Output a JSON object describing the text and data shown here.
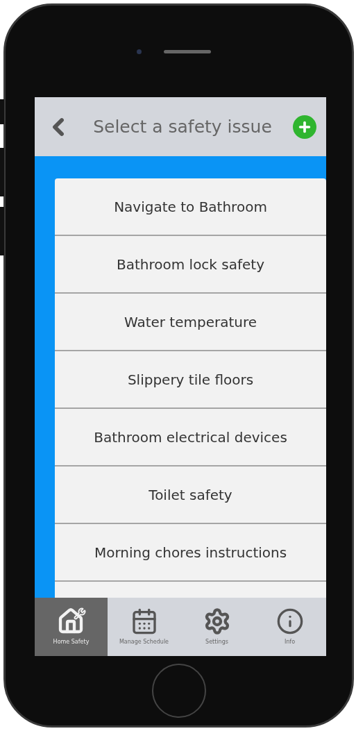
{
  "header": {
    "title": "Select a safety issue"
  },
  "issues": [
    {
      "label": "Navigate to Bathroom"
    },
    {
      "label": "Bathroom lock safety"
    },
    {
      "label": "Water temperature"
    },
    {
      "label": "Slippery tile floors"
    },
    {
      "label": "Bathroom electrical devices"
    },
    {
      "label": "Toilet safety"
    },
    {
      "label": "Morning chores instructions"
    }
  ],
  "tabs": [
    {
      "label": "Home Safety",
      "kind": "home",
      "selected": true
    },
    {
      "label": "Manage Schedule",
      "kind": "schedule",
      "selected": false
    },
    {
      "label": "Settings",
      "kind": "settings",
      "selected": false
    },
    {
      "label": "Info",
      "kind": "info",
      "selected": false
    }
  ]
}
